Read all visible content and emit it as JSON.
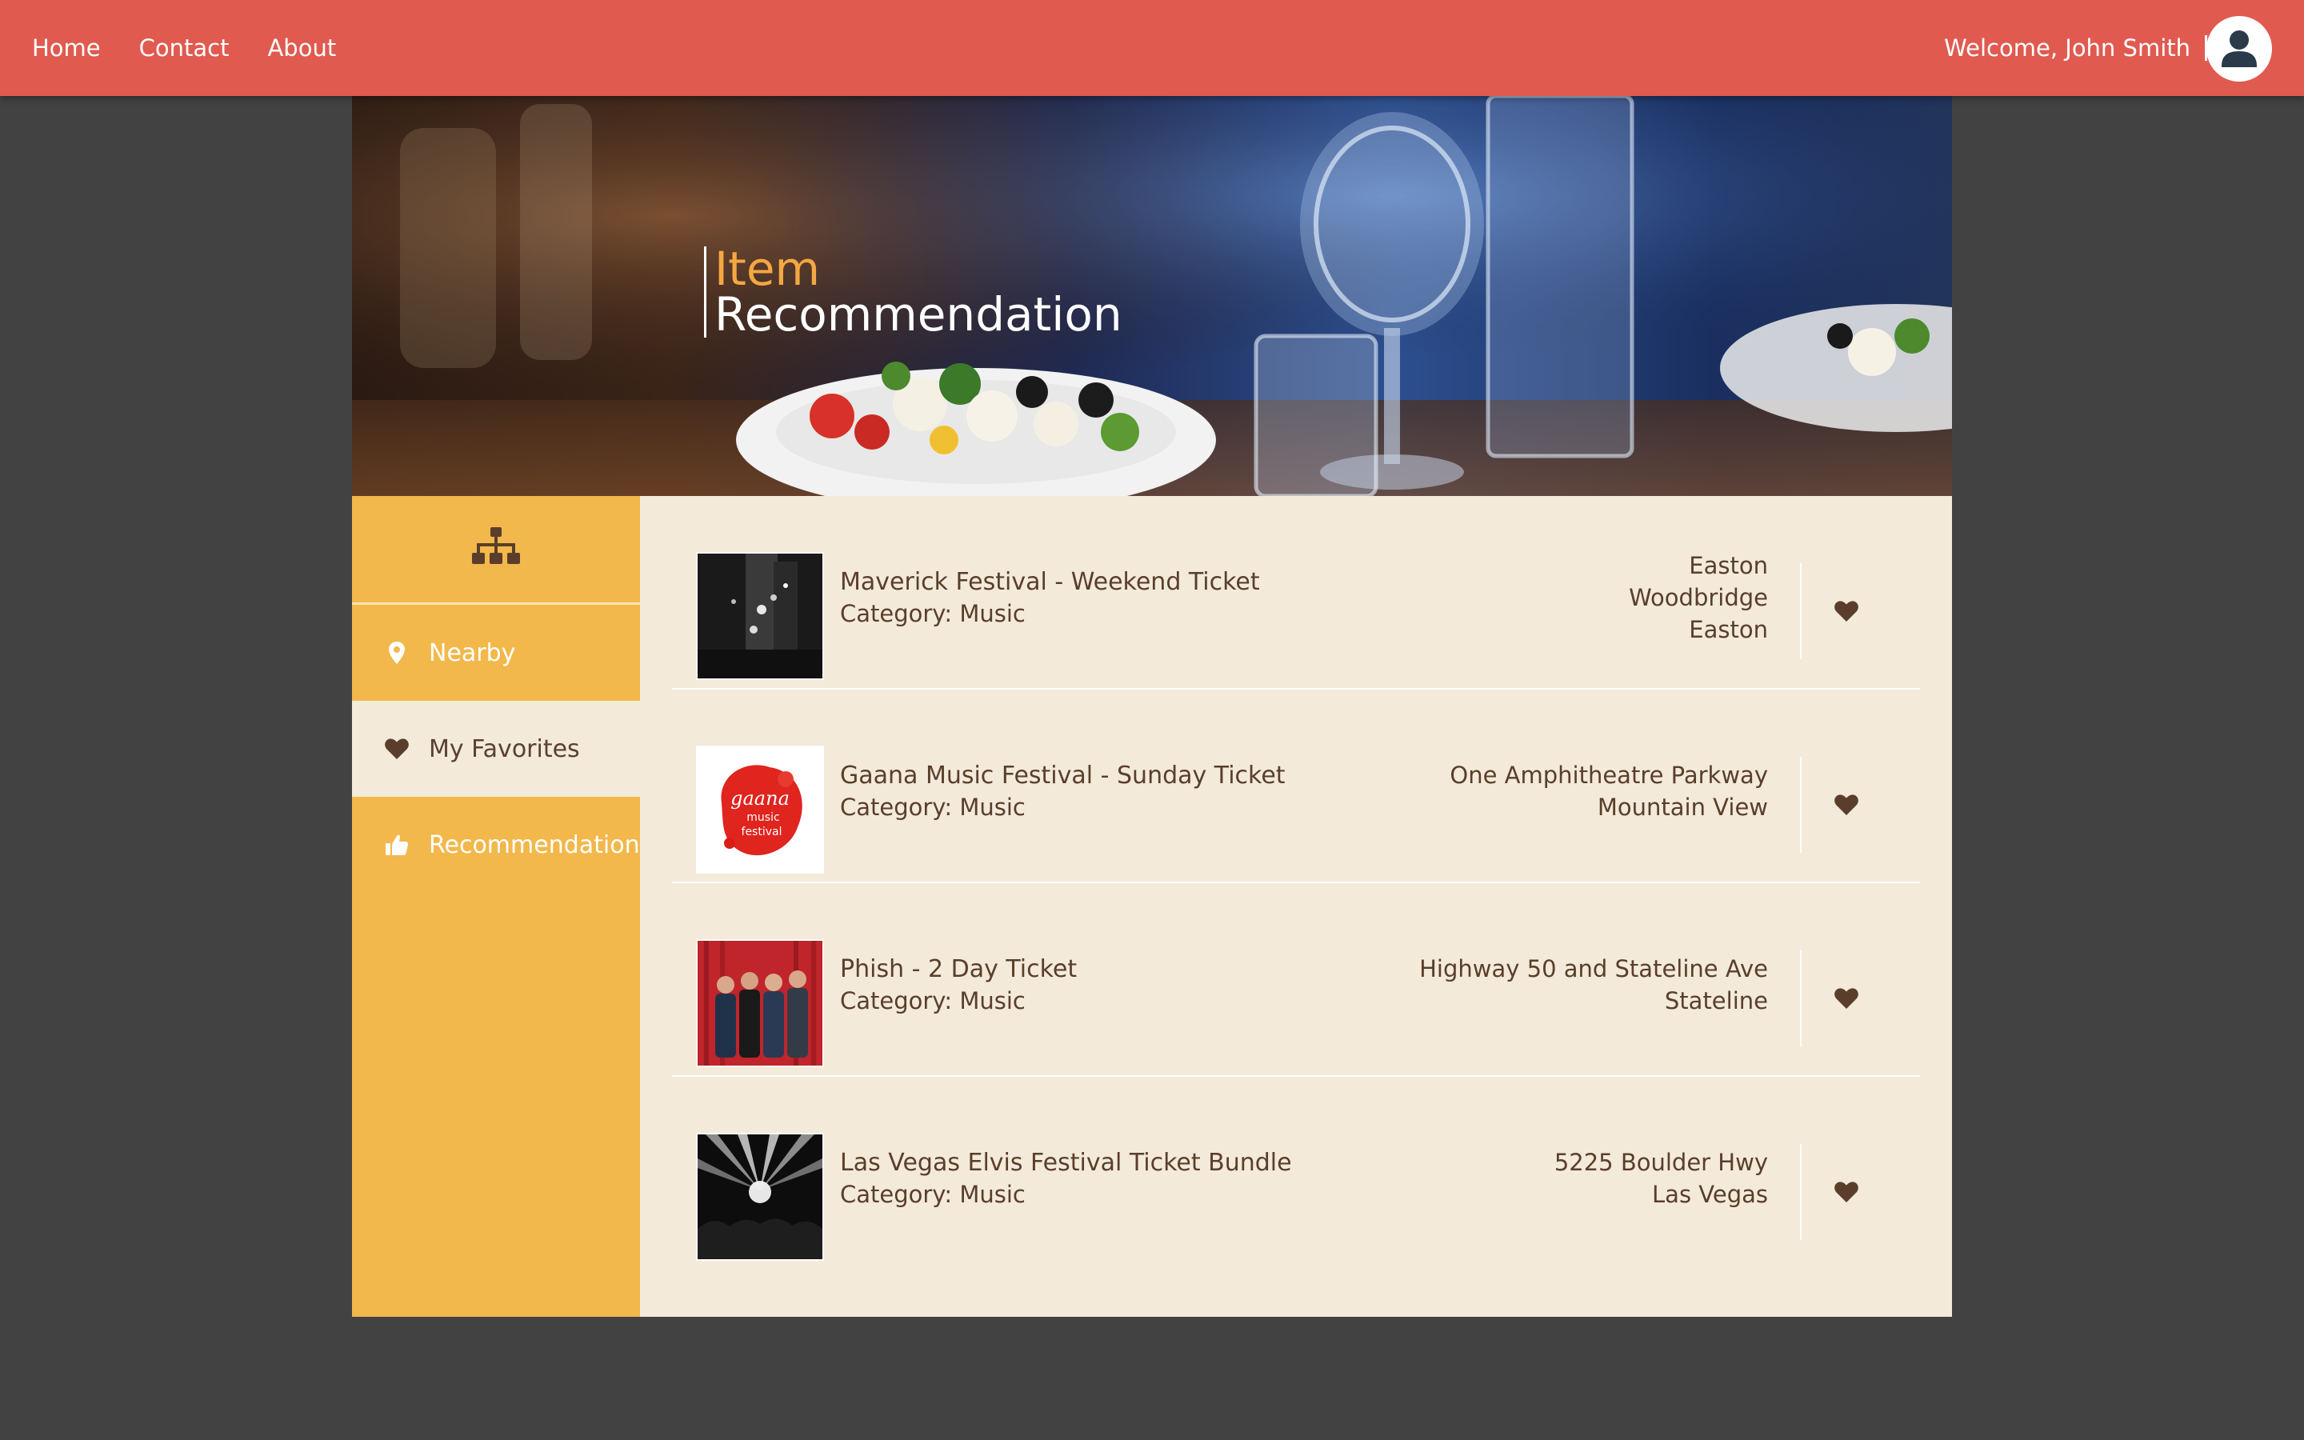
{
  "nav": {
    "links": [
      "Home",
      "Contact",
      "About"
    ],
    "welcome": "Welcome, John Smith"
  },
  "hero": {
    "title_line1": "Item",
    "title_line2": "Recommendation"
  },
  "sidebar": {
    "logo_icon": "sitemap-icon",
    "items": [
      {
        "label": "Nearby",
        "icon": "map-marker-icon",
        "active": false
      },
      {
        "label": "My Favorites",
        "icon": "heart-icon",
        "active": true
      },
      {
        "label": "Recommendation",
        "icon": "thumbs-up-icon",
        "active": false
      }
    ]
  },
  "items": [
    {
      "name": "Maverick Festival - Weekend Ticket",
      "category": "Category: Music",
      "address": [
        "Easton",
        "Woodbridge",
        "Easton"
      ]
    },
    {
      "name": "Gaana Music Festival - Sunday Ticket",
      "category": "Category: Music",
      "address": [
        "One Amphitheatre Parkway",
        "Mountain View"
      ]
    },
    {
      "name": "Phish - 2 Day Ticket",
      "category": "Category: Music",
      "address": [
        "Highway 50 and Stateline Ave",
        "Stateline"
      ]
    },
    {
      "name": "Las Vegas Elvis Festival Ticket Bundle",
      "category": "Category: Music",
      "address": [
        "5225 Boulder Hwy",
        "Las Vegas"
      ]
    }
  ],
  "colors": {
    "topbar": "#e05a50",
    "sidebar": "#f2b84b",
    "content": "#f3eada",
    "text": "#5a3e2b",
    "accent_title": "#f5a742",
    "background": "#424242"
  }
}
